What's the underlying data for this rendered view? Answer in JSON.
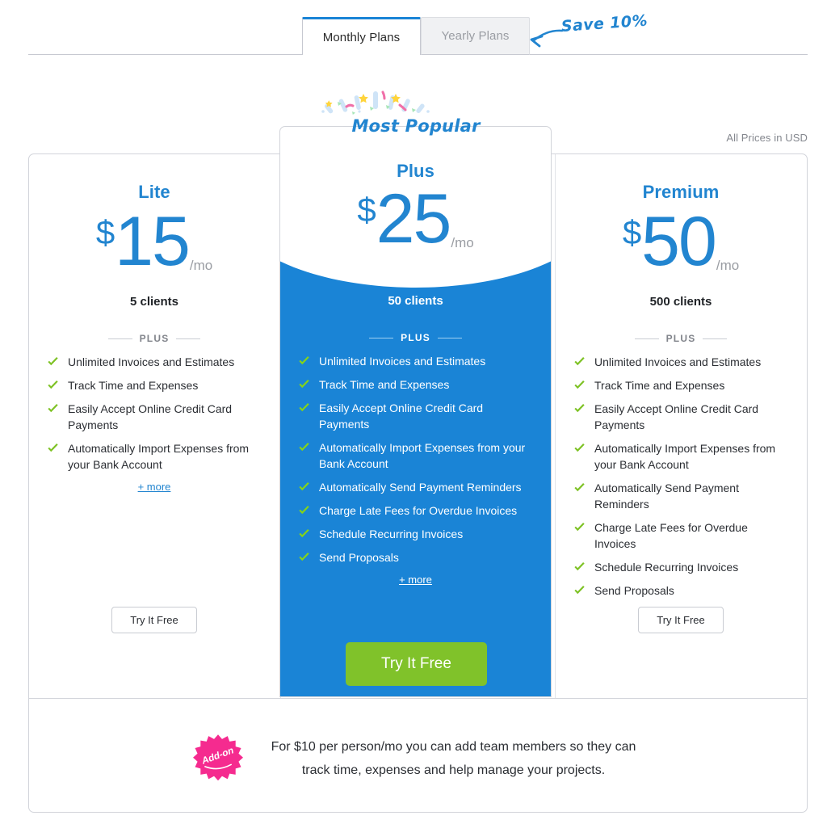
{
  "tabs": {
    "monthly": {
      "label": "Monthly Plans",
      "selected": true
    },
    "yearly": {
      "label": "Yearly Plans",
      "selected": false
    },
    "annotation": "Save 10%"
  },
  "badge": {
    "label": "Most Popular"
  },
  "currency_note": "All Prices in USD",
  "divider_label": "PLUS",
  "more_label": "+ more",
  "colors": {
    "brand_blue": "#1a84d6",
    "plan_blue": "#2285d0",
    "check_green": "#7ec225",
    "cta_green": "#80c22a",
    "addon_pink": "#f52b8f",
    "border_gray": "#d2d4da"
  },
  "plans": [
    {
      "id": "lite",
      "name": "Lite",
      "currency": "$",
      "price": "15",
      "period": "/mo",
      "clients": "5 clients",
      "features": [
        "Unlimited Invoices and Estimates",
        "Track Time and Expenses",
        "Easily Accept Online Credit Card Payments",
        "Automatically Import Expenses from your Bank Account"
      ],
      "cta": "Try It Free",
      "highlighted": false
    },
    {
      "id": "plus",
      "name": "Plus",
      "currency": "$",
      "price": "25",
      "period": "/mo",
      "clients": "50 clients",
      "features": [
        "Unlimited Invoices and Estimates",
        "Track Time and Expenses",
        "Easily Accept Online Credit Card Payments",
        "Automatically Import Expenses from your Bank Account",
        "Automatically Send Payment Reminders",
        "Charge Late Fees for Overdue Invoices",
        "Schedule Recurring Invoices",
        "Send Proposals"
      ],
      "cta": "Try It Free",
      "highlighted": true
    },
    {
      "id": "premium",
      "name": "Premium",
      "currency": "$",
      "price": "50",
      "period": "/mo",
      "clients": "500 clients",
      "features": [
        "Unlimited Invoices and Estimates",
        "Track Time and Expenses",
        "Easily Accept Online Credit Card Payments",
        "Automatically Import Expenses from your Bank Account",
        "Automatically Send Payment Reminders",
        "Charge Late Fees for Overdue Invoices",
        "Schedule Recurring Invoices",
        "Send Proposals"
      ],
      "cta": "Try It Free",
      "highlighted": false
    }
  ],
  "addon": {
    "badge_label": "Add-on",
    "text": "For $10 per person/mo you can add team members so they can track time, expenses and help manage your projects."
  }
}
